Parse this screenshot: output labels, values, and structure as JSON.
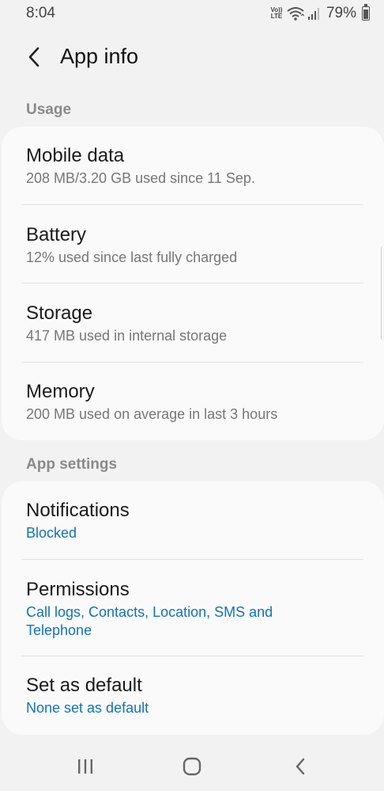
{
  "status_bar": {
    "time": "8:04",
    "volte_top": "Vo))",
    "volte_bottom": "LTE",
    "battery_percent": "79%",
    "battery_level": 0.79
  },
  "header": {
    "title": "App info",
    "back_icon": "chevron-left-icon"
  },
  "usage": {
    "section_label": "Usage",
    "items": [
      {
        "title": "Mobile data",
        "subtitle": "208 MB/3.20 GB used since 11 Sep."
      },
      {
        "title": "Battery",
        "subtitle": "12% used since last fully charged"
      },
      {
        "title": "Storage",
        "subtitle": "417 MB used in internal storage"
      },
      {
        "title": "Memory",
        "subtitle": "200 MB used on average in last 3 hours"
      }
    ]
  },
  "app_settings": {
    "section_label": "App settings",
    "items": [
      {
        "title": "Notifications",
        "subtitle": "Blocked"
      },
      {
        "title": "Permissions",
        "subtitle": "Call logs, Contacts, Location, SMS and Telephone"
      },
      {
        "title": "Set as default",
        "subtitle": "None set as default"
      }
    ]
  },
  "nav_bar": {
    "recents_icon": "recents-icon",
    "home_icon": "home-icon",
    "back_icon": "back-icon"
  },
  "colors": {
    "background": "#f2f2f2",
    "card": "#fafafa",
    "accent_blue": "#1373b8",
    "secondary_text": "#777777"
  }
}
